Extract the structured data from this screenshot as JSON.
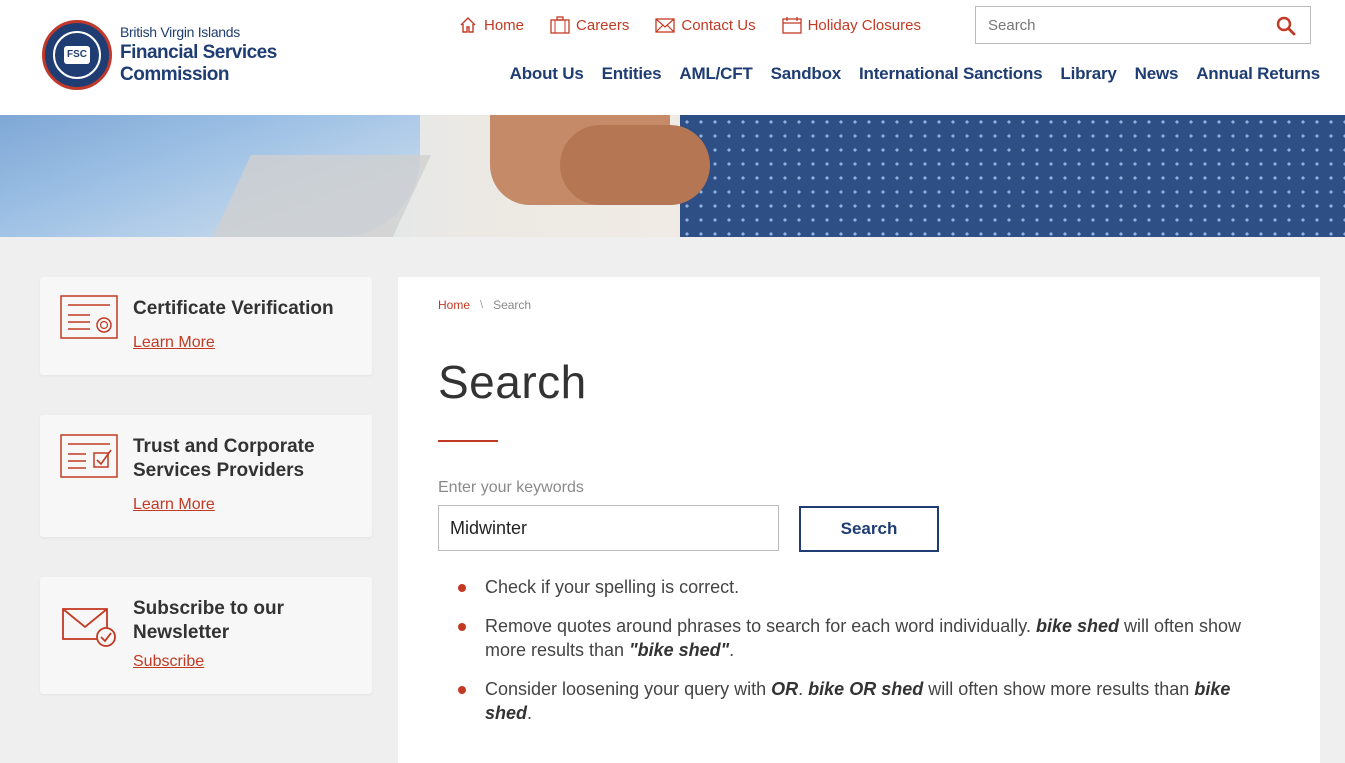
{
  "logo": {
    "seal_text": "FSC",
    "line1": "British Virgin Islands",
    "line2": "Financial Services Commission"
  },
  "util_nav": [
    {
      "label": "Home",
      "icon": "home-icon"
    },
    {
      "label": "Careers",
      "icon": "briefcase-icon"
    },
    {
      "label": "Contact Us",
      "icon": "envelope-icon"
    },
    {
      "label": "Holiday Closures",
      "icon": "calendar-icon"
    }
  ],
  "header_search": {
    "placeholder": "Search"
  },
  "main_nav": [
    "About Us",
    "Entities",
    "AML/CFT",
    "Sandbox",
    "International Sanctions",
    "Library",
    "News",
    "Annual Returns"
  ],
  "sidebar": {
    "cards": [
      {
        "title": "Certificate Verification",
        "link": "Learn More",
        "icon": "certificate-icon"
      },
      {
        "title": "Trust and Corporate Services Providers",
        "link": "Learn More",
        "icon": "checklist-icon"
      },
      {
        "title": "Subscribe to our Newsletter",
        "link": "Subscribe",
        "icon": "mail-check-icon"
      }
    ]
  },
  "breadcrumb": {
    "home": "Home",
    "separator": "\\",
    "current": "Search"
  },
  "page": {
    "title": "Search",
    "keyword_label": "Enter your keywords",
    "keyword_value": "Midwinter",
    "button": "Search"
  },
  "tips": [
    {
      "parts": [
        {
          "t": "Check if your spelling is correct.",
          "em": false
        }
      ]
    },
    {
      "parts": [
        {
          "t": "Remove quotes around phrases to search for each word individually. ",
          "em": false
        },
        {
          "t": "bike shed",
          "em": true
        },
        {
          "t": " will often show more results than ",
          "em": false
        },
        {
          "t": "\"bike shed\"",
          "em": true
        },
        {
          "t": ".",
          "em": false
        }
      ]
    },
    {
      "parts": [
        {
          "t": "Consider loosening your query with ",
          "em": false
        },
        {
          "t": "OR",
          "em": true
        },
        {
          "t": ". ",
          "em": false
        },
        {
          "t": "bike OR shed",
          "em": true
        },
        {
          "t": " will often show more results than ",
          "em": false
        },
        {
          "t": "bike shed",
          "em": true
        },
        {
          "t": ".",
          "em": false
        }
      ]
    }
  ],
  "colors": {
    "accent": "#c23a23",
    "navy": "#1f3d73",
    "background": "#efefef"
  }
}
